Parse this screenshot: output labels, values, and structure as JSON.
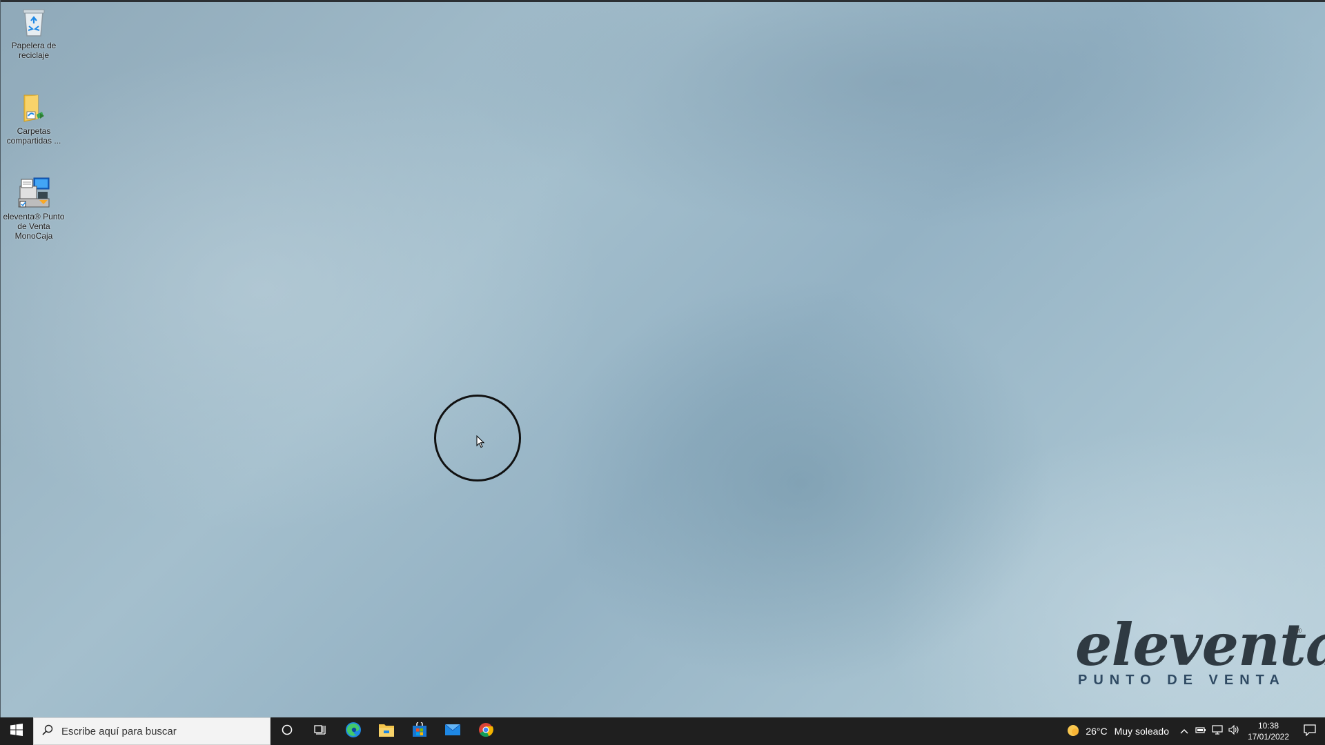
{
  "desktop_icons": [
    {
      "name": "recycle-bin-icon",
      "label": "Papelera de reciclaje"
    },
    {
      "name": "shared-folders-icon",
      "label": "Carpetas compartidas ..."
    },
    {
      "name": "eleventa-app-icon",
      "label": "eleventa® Punto de Venta MonoCaja"
    }
  ],
  "branding": {
    "name": "eleventa",
    "registered": "®",
    "subtitle": "PUNTO DE VENTA"
  },
  "taskbar": {
    "search_placeholder": "Escribe aquí para buscar",
    "pinned": [
      "cortana-icon",
      "task-view-icon",
      "edge-icon",
      "file-explorer-icon",
      "store-icon",
      "mail-icon",
      "chrome-icon"
    ]
  },
  "tray": {
    "temperature": "26°C",
    "weather": "Muy soleado",
    "time": "10:38",
    "date": "17/01/2022"
  },
  "colors": {
    "taskbar": "#1f1f1f",
    "search_bg": "#f3f3f3",
    "brand_text": "#2f3a42",
    "brand_sub": "#2f4a63"
  }
}
